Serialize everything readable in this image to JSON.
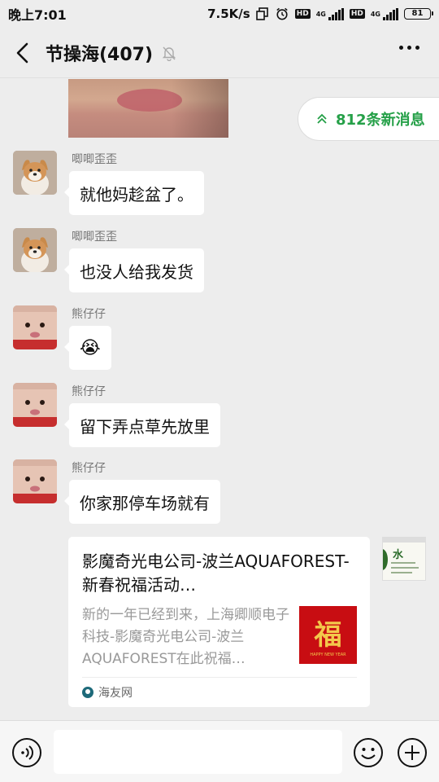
{
  "status_bar": {
    "time": "晚上7:01",
    "speed": "7.5K/s",
    "battery": "81",
    "net1": "4G",
    "net2": "4G"
  },
  "header": {
    "title": "节操海(407)"
  },
  "new_messages": {
    "label": "812条新消息"
  },
  "messages": [
    {
      "sender": "唧唧歪歪",
      "text": "就他妈趁盆了。"
    },
    {
      "sender": "唧唧歪歪",
      "text": "也没人给我发货"
    },
    {
      "sender": "熊仔仔",
      "text": "😭"
    },
    {
      "sender": "熊仔仔",
      "text": "留下弄点草先放里"
    },
    {
      "sender": "熊仔仔",
      "text": "你家那停车场就有"
    }
  ],
  "link_card": {
    "title": "影魔奇光电公司-波兰AQUAFOREST-新春祝福活动…",
    "description": "新的一年已经到来，上海卿顺电子科技-影魔奇光电公司-波兰AQUAFOREST在此祝福…",
    "thumb_char": "福",
    "thumb_sub": "HAPPY NEW YEAR",
    "source": "海友网"
  },
  "side_thumb": {
    "char": "水"
  },
  "colors": {
    "accent_green": "#25a048",
    "background": "#ededed",
    "bubble": "#ffffff"
  }
}
